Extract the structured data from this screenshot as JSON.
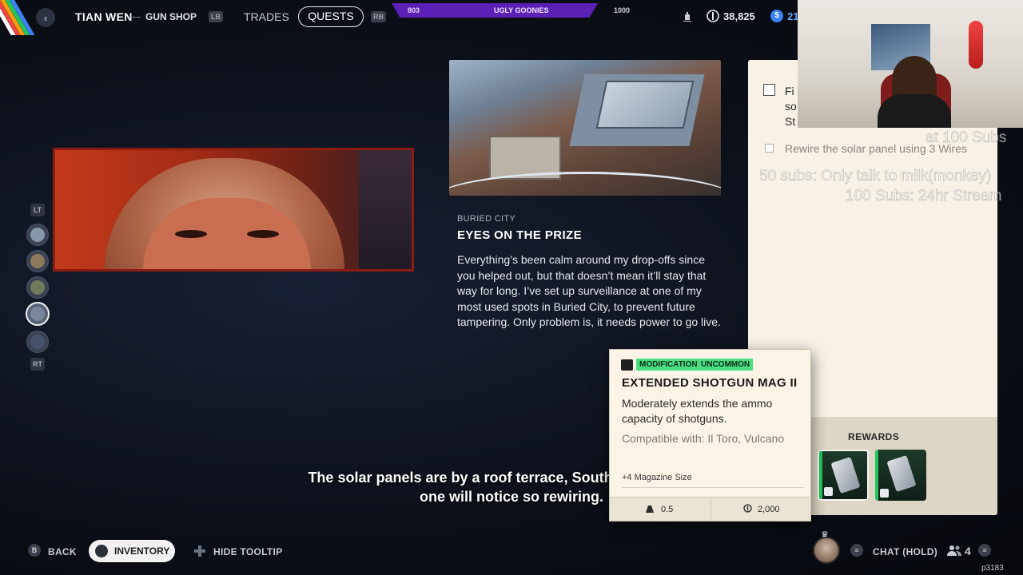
{
  "topbar": {
    "vendor_name": "TIAN WEN",
    "vendor_sep": "—",
    "vendor_shop": "GUN SHOP",
    "lb": "LB",
    "rb": "RB",
    "tabs": [
      {
        "label": "TRADES",
        "active": false
      },
      {
        "label": "QUESTS",
        "active": true
      }
    ],
    "faction": {
      "level_left": "803",
      "name": "UGLY GOONIES",
      "level_right": "1000",
      "progress": 0.0
    },
    "currencies": [
      {
        "icon": "coin-icon",
        "value": "38,825"
      },
      {
        "icon": "token-icon",
        "value": "21"
      }
    ]
  },
  "sidenav": {
    "lt": "LT",
    "rt": "RT",
    "items": [
      {
        "name": "quest-thumb-1",
        "active": false
      },
      {
        "name": "quest-thumb-2",
        "active": false
      },
      {
        "name": "quest-thumb-3",
        "active": false
      },
      {
        "name": "quest-thumb-4",
        "active": true
      },
      {
        "name": "quest-thumb-5",
        "active": false
      }
    ]
  },
  "quest": {
    "location": "BURIED CITY",
    "title": "EYES ON THE PRIZE",
    "description": "Everything’s been calm around my drop-offs since you helped out, but that doesn’t mean it’ll stay that way for long. I’ve set up surveillance at one of my most used spots in Buried City, to prevent future tampering. Only problem is, it needs power to go live."
  },
  "objectives": [
    {
      "text": "Fi so St",
      "checked": false
    },
    {
      "text": "Rewire the solar panel using 3 Wires",
      "checked": false
    }
  ],
  "rewards": {
    "label": "REWARDS"
  },
  "tooltip": {
    "category": "MODIFICATION",
    "rarity": "UNCOMMON",
    "title": "EXTENDED SHOTGUN MAG II",
    "description": "Moderately extends the ammo capacity of shotguns.",
    "compatible": "Compatible with: Il Toro, Vulcano",
    "stat": "+4 Magazine Size",
    "weight": "0.5",
    "price": "2,000"
  },
  "subtitle": "The solar panels are by a roof terrace, Southern Station. No one will notice so rewiring.",
  "bottombar": {
    "back_key": "B",
    "back_label": "BACK",
    "inventory_label": "INVENTORY",
    "hide_tooltip_label": "HIDE TOOLTIP",
    "chat_label": "CHAT (HOLD)",
    "party_count": "4"
  },
  "stream": {
    "goal_1": "at 100 Subs",
    "goal_2": "50 subs: Only talk to milk(monkey)",
    "goal_3": "100 Subs: 24hr Stream",
    "watermark": "p3183"
  },
  "colors": {
    "uncommon": "#4ade80",
    "faction": "#5b21b6",
    "panel": "#f7f1e6"
  }
}
